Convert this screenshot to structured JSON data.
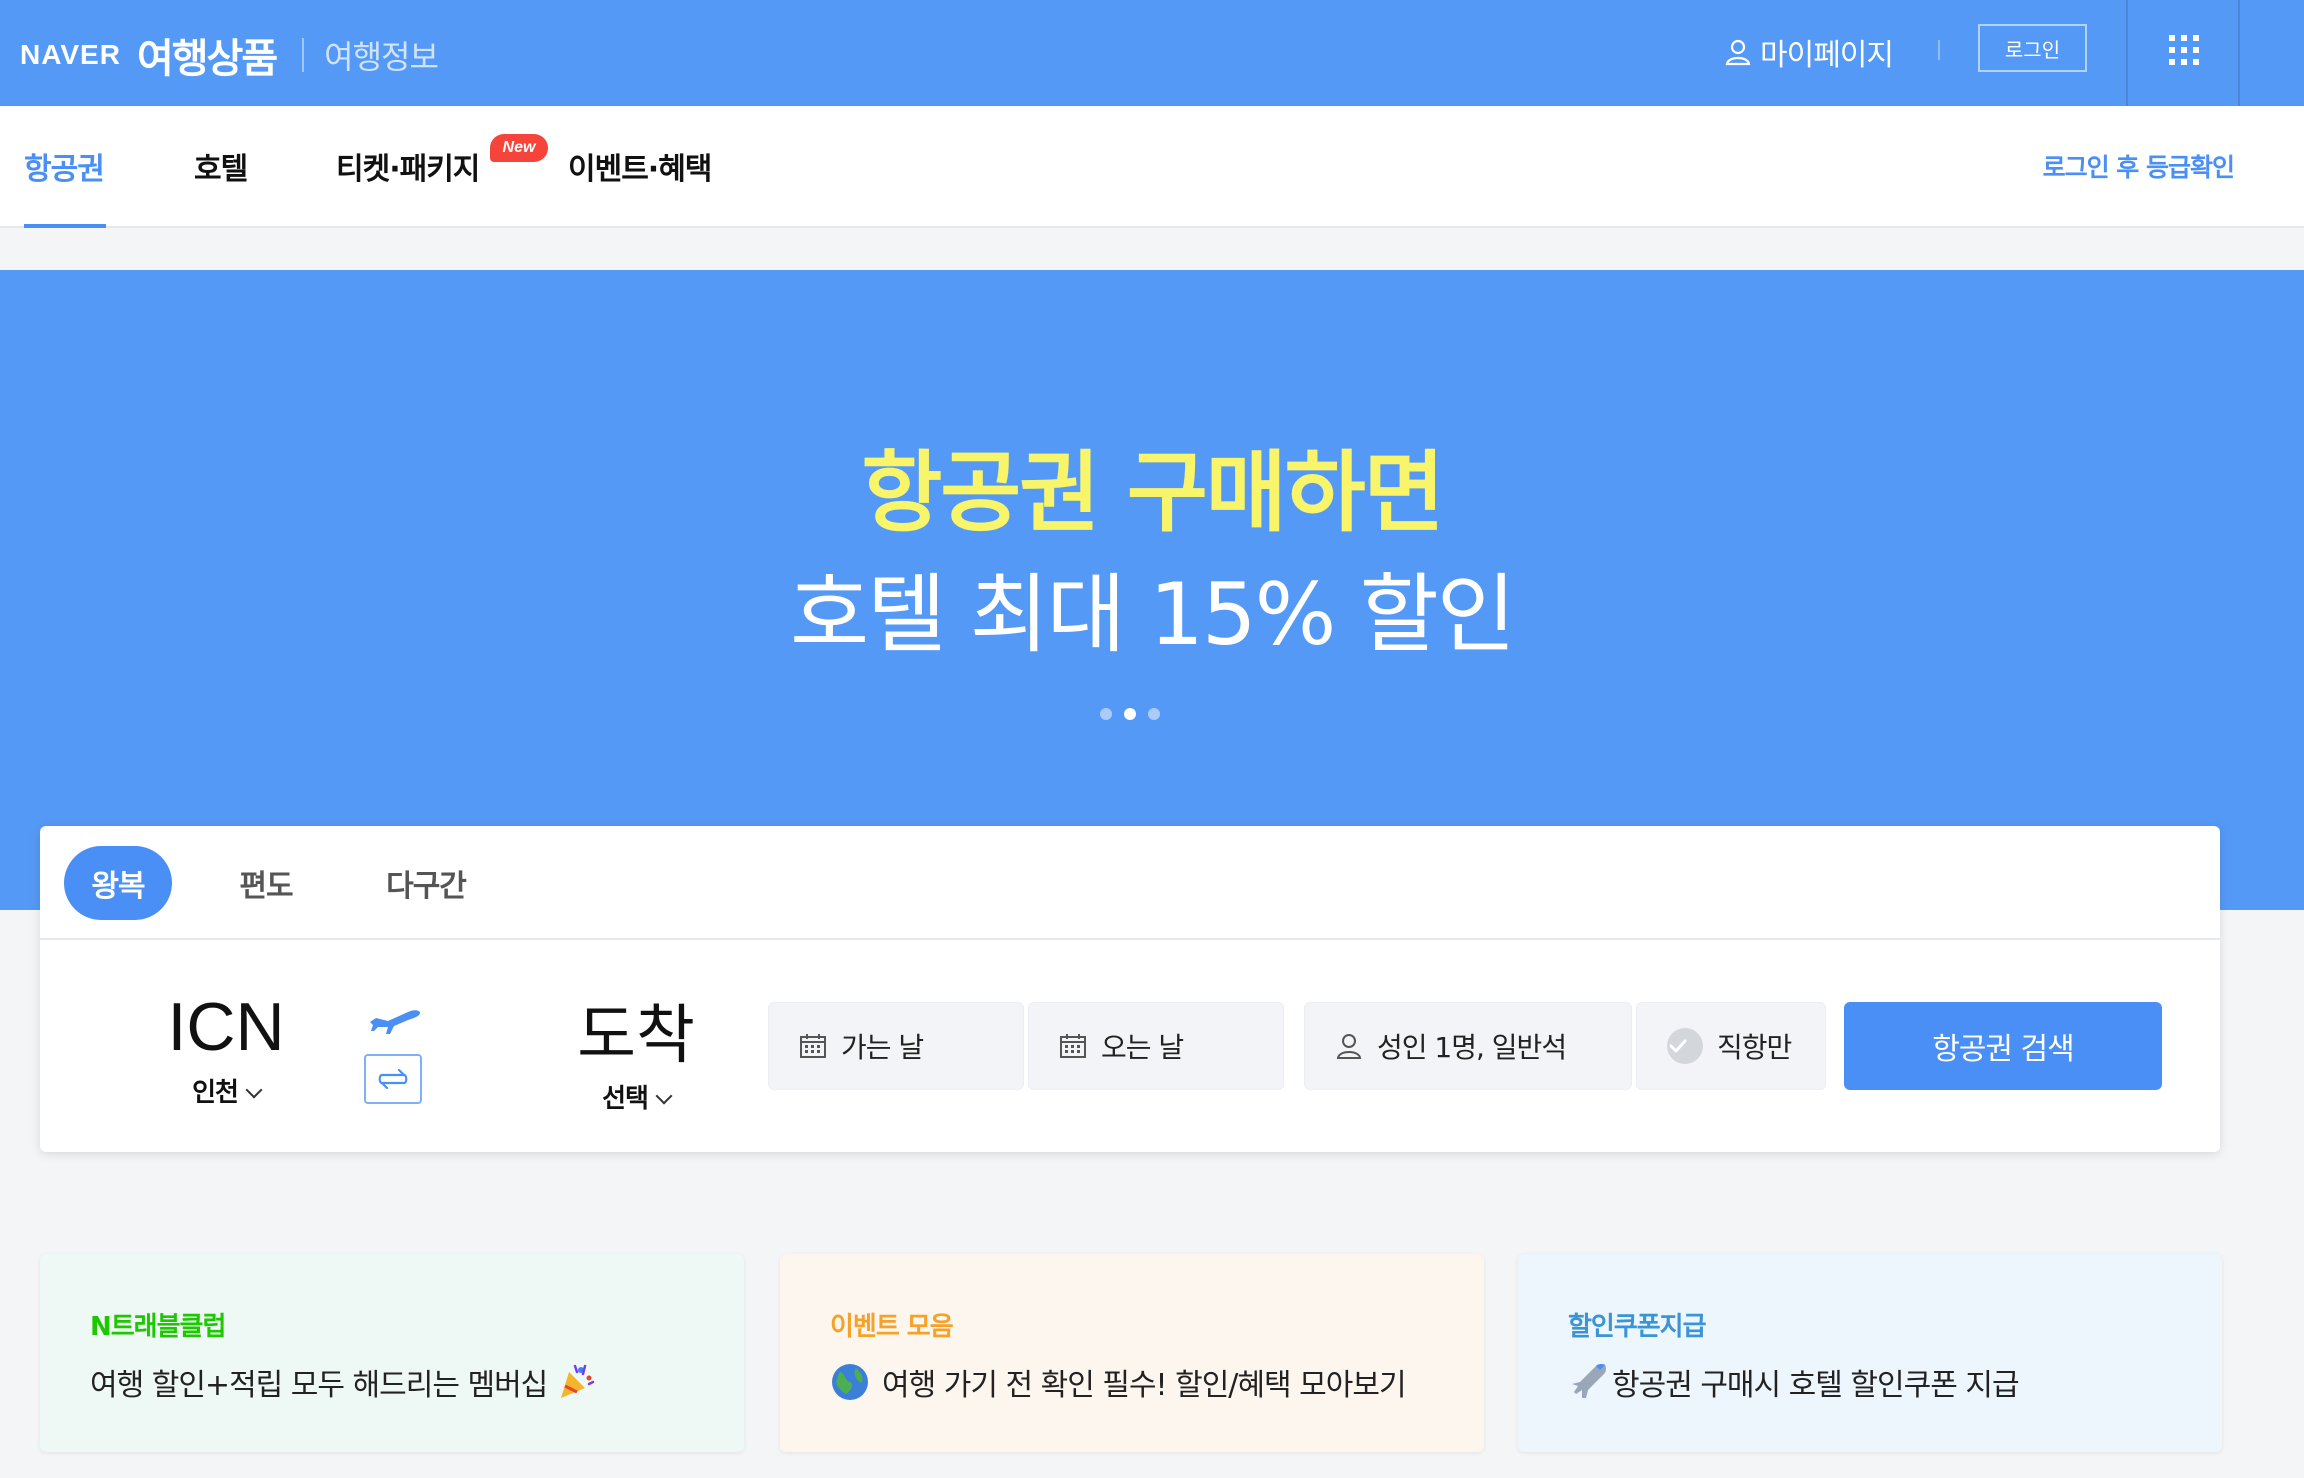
{
  "header": {
    "brand_naver": "NAVER",
    "brand_product": "여행상품",
    "brand_info": "여행정보",
    "mypage_label": "마이페이지",
    "login_label": "로그인"
  },
  "nav": {
    "tabs": [
      {
        "label": "항공권",
        "active": true
      },
      {
        "label": "호텔"
      },
      {
        "label": "티켓·패키지"
      },
      {
        "label": "이벤트·혜택"
      }
    ],
    "new_badge": "New",
    "grade_link": "로그인 후 등급확인"
  },
  "banner": {
    "line1": "항공권 구매하면",
    "line2": "호텔 최대 15% 할인",
    "slide_index": 2,
    "slide_count": 3
  },
  "search": {
    "trip_types": [
      "왕복",
      "편도",
      "다구간"
    ],
    "origin": {
      "code": "ICN",
      "city": "인천"
    },
    "destination": {
      "code": "도착",
      "city": "선택"
    },
    "depart_date": "가는 날",
    "return_date": "오는 날",
    "passengers": "성인 1명, 일반석",
    "direct_only": "직항만",
    "search_button": "항공권 검색"
  },
  "promos": [
    {
      "title": "N트래블클럽",
      "desc": "여행 할인+적립 모두 해드리는 멤버십",
      "title_color": "#1ec800",
      "bg": "#eef8f5"
    },
    {
      "title": "이벤트 모음",
      "desc": "여행 가기 전 확인 필수! 할인/혜택 모아보기",
      "title_color": "#f5a12a",
      "bg": "#fdf6ef"
    },
    {
      "title": "할인쿠폰지급",
      "desc": "항공권 구매시 호텔 할인쿠폰 지급",
      "title_color": "#3a94d6",
      "bg": "#eef6fd"
    }
  ],
  "colors": {
    "brand_blue": "#5599f6",
    "accent_blue": "#4a8ff5",
    "banner_yellow": "#f8f56a",
    "badge_red": "#f6443a"
  },
  "icons": [
    "user-icon",
    "apps-grid-icon",
    "airplane-icon",
    "swap-icon",
    "calendar-icon",
    "check-icon",
    "party-popper-icon",
    "globe-icon",
    "airplane-emoji-icon"
  ]
}
